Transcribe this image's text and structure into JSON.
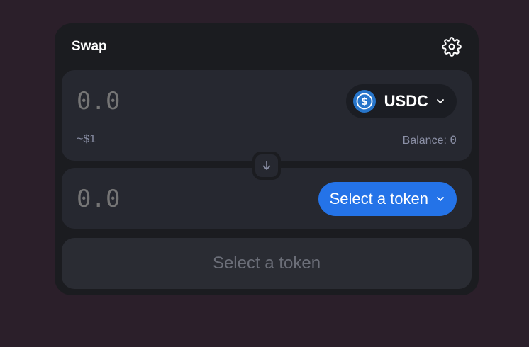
{
  "swap": {
    "title": "Swap",
    "input": {
      "amount": "0.0",
      "token_symbol": "USDC",
      "usd_value": "~$1",
      "balance_label": "Balance:",
      "balance_value": "0"
    },
    "output": {
      "amount": "0.0",
      "select_label": "Select a token"
    },
    "action_label": "Select a token"
  },
  "colors": {
    "background": "#2b1f2a",
    "card": "#1b1c20",
    "panel": "#262830",
    "accent": "#2473e8",
    "usdc": "#2775ca"
  },
  "icons": {
    "settings": "gear-icon",
    "switch": "arrow-down-icon",
    "token": "usdc-icon",
    "dropdown": "chevron-down-icon"
  }
}
